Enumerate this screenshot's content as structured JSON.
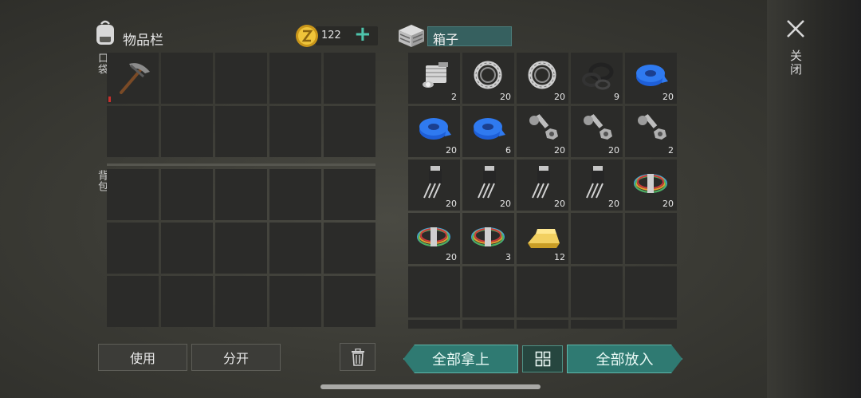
{
  "inventory": {
    "title": "物品栏",
    "coins": "122",
    "coin_plus": "+",
    "pocket_label": "口袋",
    "backpack_label": "背包",
    "pocket_slots": [
      {
        "item": "pickaxe-icon",
        "qty": ""
      },
      {
        "item": "",
        "qty": ""
      },
      {
        "item": "",
        "qty": ""
      },
      {
        "item": "",
        "qty": ""
      },
      {
        "item": "",
        "qty": ""
      },
      {
        "item": "",
        "qty": ""
      },
      {
        "item": "",
        "qty": ""
      },
      {
        "item": "",
        "qty": ""
      },
      {
        "item": "",
        "qty": ""
      },
      {
        "item": "",
        "qty": ""
      }
    ],
    "backpack_slot_count": 15
  },
  "container": {
    "name": "箱子",
    "slots": [
      {
        "item": "engine-block-icon",
        "qty": "2"
      },
      {
        "item": "ball-bearing-icon",
        "qty": "20"
      },
      {
        "item": "ball-bearing-icon",
        "qty": "20"
      },
      {
        "item": "rubber-seal-icon",
        "qty": "9"
      },
      {
        "item": "blue-tape-icon",
        "qty": "20"
      },
      {
        "item": "blue-tape-icon",
        "qty": "20"
      },
      {
        "item": "blue-tape-icon",
        "qty": "6"
      },
      {
        "item": "bolt-nut-icon",
        "qty": "20"
      },
      {
        "item": "bolt-nut-icon",
        "qty": "20"
      },
      {
        "item": "bolt-nut-icon",
        "qty": "2"
      },
      {
        "item": "transistor-icon",
        "qty": "20"
      },
      {
        "item": "transistor-icon",
        "qty": "20"
      },
      {
        "item": "transistor-icon",
        "qty": "20"
      },
      {
        "item": "transistor-icon",
        "qty": "20"
      },
      {
        "item": "wire-coil-icon",
        "qty": "20"
      },
      {
        "item": "wire-coil-icon",
        "qty": "20"
      },
      {
        "item": "wire-coil-icon",
        "qty": "3"
      },
      {
        "item": "gold-bar-icon",
        "qty": "12"
      },
      {
        "item": "",
        "qty": ""
      },
      {
        "item": "",
        "qty": ""
      },
      {
        "item": "",
        "qty": ""
      },
      {
        "item": "",
        "qty": ""
      },
      {
        "item": "",
        "qty": ""
      },
      {
        "item": "",
        "qty": ""
      },
      {
        "item": "",
        "qty": ""
      },
      {
        "item": "",
        "qty": ""
      },
      {
        "item": "",
        "qty": ""
      },
      {
        "item": "",
        "qty": ""
      },
      {
        "item": "",
        "qty": ""
      },
      {
        "item": "",
        "qty": ""
      }
    ]
  },
  "buttons": {
    "use": "使用",
    "split": "分开",
    "take_all": "全部拿上",
    "put_all": "全部放入"
  },
  "close_label": "关闭",
  "colors": {
    "accent_teal": "#2f7a72",
    "coin_gold": "#e0b020",
    "durability_red": "#c9302c"
  }
}
